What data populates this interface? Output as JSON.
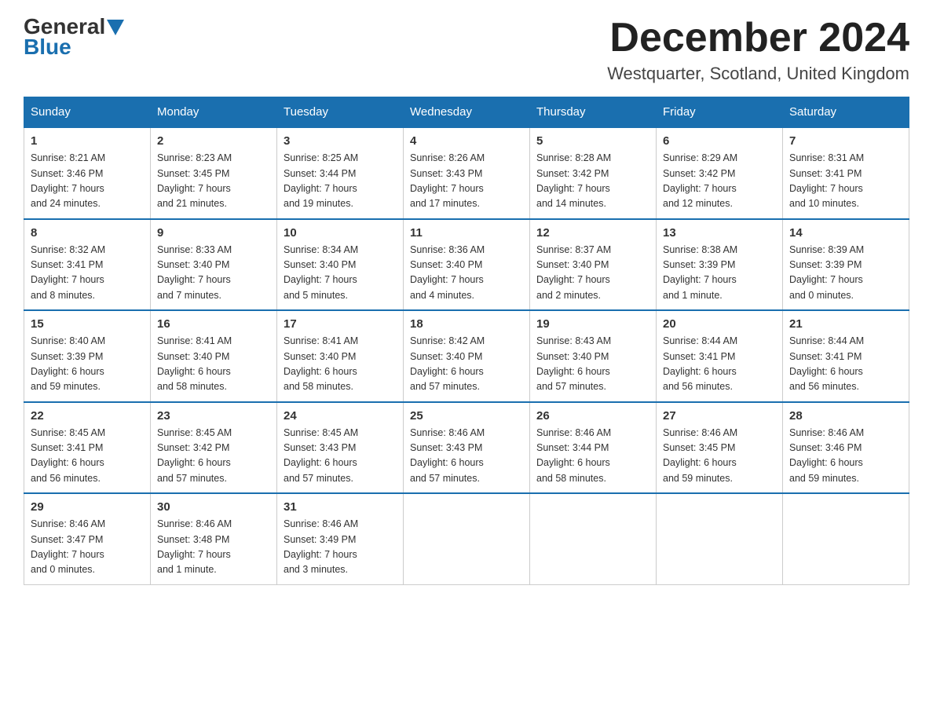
{
  "header": {
    "logo_line1": "General",
    "logo_line2": "Blue",
    "month_title": "December 2024",
    "location": "Westquarter, Scotland, United Kingdom"
  },
  "days_of_week": [
    "Sunday",
    "Monday",
    "Tuesday",
    "Wednesday",
    "Thursday",
    "Friday",
    "Saturday"
  ],
  "weeks": [
    [
      {
        "day": "1",
        "sunrise": "8:21 AM",
        "sunset": "3:46 PM",
        "daylight": "7 hours and 24 minutes."
      },
      {
        "day": "2",
        "sunrise": "8:23 AM",
        "sunset": "3:45 PM",
        "daylight": "7 hours and 21 minutes."
      },
      {
        "day": "3",
        "sunrise": "8:25 AM",
        "sunset": "3:44 PM",
        "daylight": "7 hours and 19 minutes."
      },
      {
        "day": "4",
        "sunrise": "8:26 AM",
        "sunset": "3:43 PM",
        "daylight": "7 hours and 17 minutes."
      },
      {
        "day": "5",
        "sunrise": "8:28 AM",
        "sunset": "3:42 PM",
        "daylight": "7 hours and 14 minutes."
      },
      {
        "day": "6",
        "sunrise": "8:29 AM",
        "sunset": "3:42 PM",
        "daylight": "7 hours and 12 minutes."
      },
      {
        "day": "7",
        "sunrise": "8:31 AM",
        "sunset": "3:41 PM",
        "daylight": "7 hours and 10 minutes."
      }
    ],
    [
      {
        "day": "8",
        "sunrise": "8:32 AM",
        "sunset": "3:41 PM",
        "daylight": "7 hours and 8 minutes."
      },
      {
        "day": "9",
        "sunrise": "8:33 AM",
        "sunset": "3:40 PM",
        "daylight": "7 hours and 7 minutes."
      },
      {
        "day": "10",
        "sunrise": "8:34 AM",
        "sunset": "3:40 PM",
        "daylight": "7 hours and 5 minutes."
      },
      {
        "day": "11",
        "sunrise": "8:36 AM",
        "sunset": "3:40 PM",
        "daylight": "7 hours and 4 minutes."
      },
      {
        "day": "12",
        "sunrise": "8:37 AM",
        "sunset": "3:40 PM",
        "daylight": "7 hours and 2 minutes."
      },
      {
        "day": "13",
        "sunrise": "8:38 AM",
        "sunset": "3:39 PM",
        "daylight": "7 hours and 1 minute."
      },
      {
        "day": "14",
        "sunrise": "8:39 AM",
        "sunset": "3:39 PM",
        "daylight": "7 hours and 0 minutes."
      }
    ],
    [
      {
        "day": "15",
        "sunrise": "8:40 AM",
        "sunset": "3:39 PM",
        "daylight": "6 hours and 59 minutes."
      },
      {
        "day": "16",
        "sunrise": "8:41 AM",
        "sunset": "3:40 PM",
        "daylight": "6 hours and 58 minutes."
      },
      {
        "day": "17",
        "sunrise": "8:41 AM",
        "sunset": "3:40 PM",
        "daylight": "6 hours and 58 minutes."
      },
      {
        "day": "18",
        "sunrise": "8:42 AM",
        "sunset": "3:40 PM",
        "daylight": "6 hours and 57 minutes."
      },
      {
        "day": "19",
        "sunrise": "8:43 AM",
        "sunset": "3:40 PM",
        "daylight": "6 hours and 57 minutes."
      },
      {
        "day": "20",
        "sunrise": "8:44 AM",
        "sunset": "3:41 PM",
        "daylight": "6 hours and 56 minutes."
      },
      {
        "day": "21",
        "sunrise": "8:44 AM",
        "sunset": "3:41 PM",
        "daylight": "6 hours and 56 minutes."
      }
    ],
    [
      {
        "day": "22",
        "sunrise": "8:45 AM",
        "sunset": "3:41 PM",
        "daylight": "6 hours and 56 minutes."
      },
      {
        "day": "23",
        "sunrise": "8:45 AM",
        "sunset": "3:42 PM",
        "daylight": "6 hours and 57 minutes."
      },
      {
        "day": "24",
        "sunrise": "8:45 AM",
        "sunset": "3:43 PM",
        "daylight": "6 hours and 57 minutes."
      },
      {
        "day": "25",
        "sunrise": "8:46 AM",
        "sunset": "3:43 PM",
        "daylight": "6 hours and 57 minutes."
      },
      {
        "day": "26",
        "sunrise": "8:46 AM",
        "sunset": "3:44 PM",
        "daylight": "6 hours and 58 minutes."
      },
      {
        "day": "27",
        "sunrise": "8:46 AM",
        "sunset": "3:45 PM",
        "daylight": "6 hours and 59 minutes."
      },
      {
        "day": "28",
        "sunrise": "8:46 AM",
        "sunset": "3:46 PM",
        "daylight": "6 hours and 59 minutes."
      }
    ],
    [
      {
        "day": "29",
        "sunrise": "8:46 AM",
        "sunset": "3:47 PM",
        "daylight": "7 hours and 0 minutes."
      },
      {
        "day": "30",
        "sunrise": "8:46 AM",
        "sunset": "3:48 PM",
        "daylight": "7 hours and 1 minute."
      },
      {
        "day": "31",
        "sunrise": "8:46 AM",
        "sunset": "3:49 PM",
        "daylight": "7 hours and 3 minutes."
      },
      null,
      null,
      null,
      null
    ]
  ]
}
